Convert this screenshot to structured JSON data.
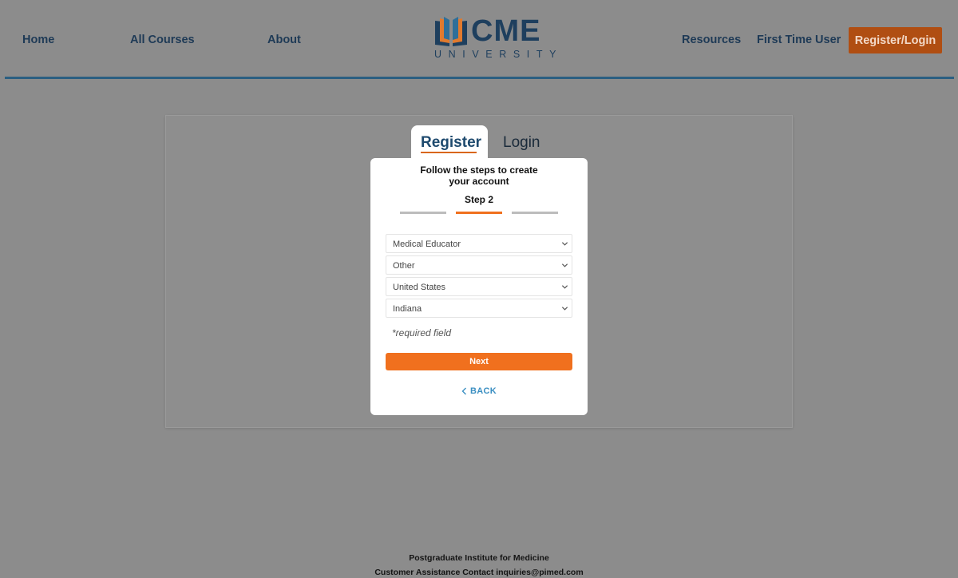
{
  "nav": {
    "home": "Home",
    "all_courses": "All Courses",
    "about": "About",
    "resources": "Resources",
    "first_time_user": "First Time User",
    "register_login": "Register/Login"
  },
  "logo": {
    "wordmark": "CME",
    "subtitle": "UNIVERSITY",
    "icon": "open-book-icon"
  },
  "tabs": {
    "register": "Register",
    "login": "Login"
  },
  "modal": {
    "title_line1": "Follow the steps to create",
    "title_line2": "your account",
    "step_label": "Step 2",
    "steps_total": 3,
    "current_step": 2,
    "fields": {
      "profession": "Medical Educator",
      "specialty": "Other",
      "country": "United States",
      "state": "Indiana"
    },
    "required_note": "*required field",
    "next_label": "Next",
    "back_label": "BACK"
  },
  "footer": {
    "org": "Postgraduate Institute for Medicine",
    "contact": "Customer Assistance Contact inquiries@pimed.com"
  },
  "colors": {
    "accent_orange": "#f0701e",
    "nav_blue": "#1e3a56",
    "rule_blue": "#2b5f82",
    "back_link_blue": "#3b8fc2"
  }
}
